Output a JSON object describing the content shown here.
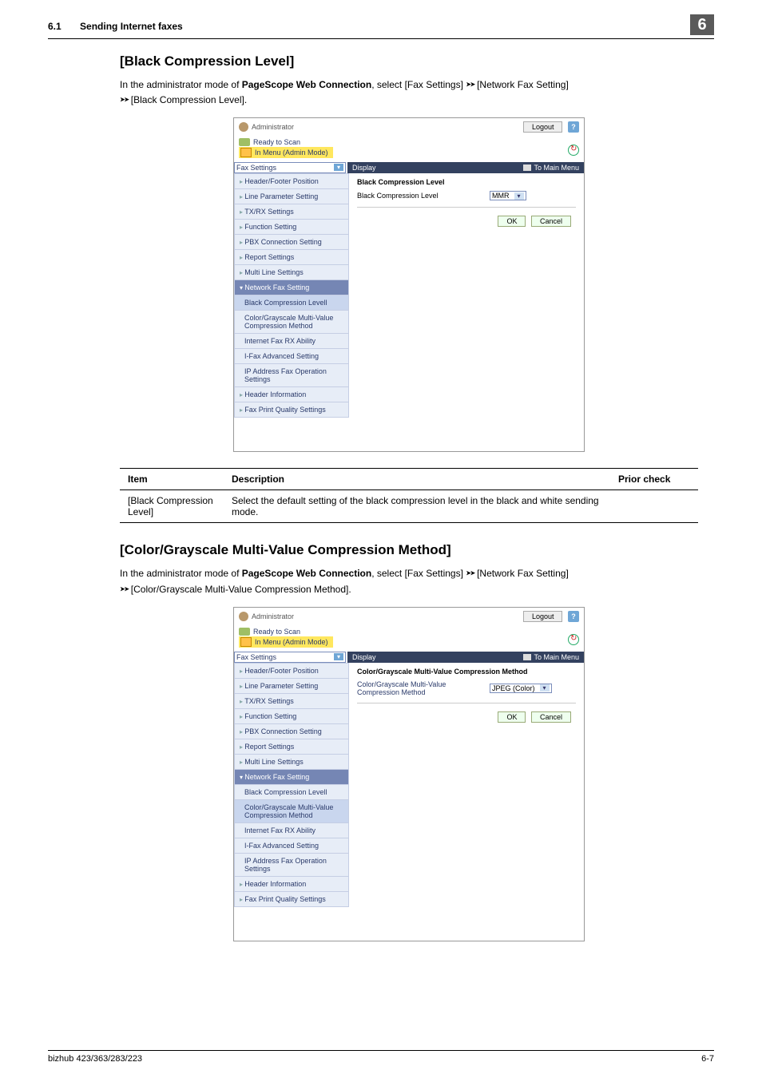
{
  "header": {
    "section_no": "6.1",
    "section_title": "Sending Internet faxes",
    "chapter_no": "6"
  },
  "section1": {
    "title": "[Black Compression Level]",
    "intro_a": "In the administrator mode of ",
    "intro_bold": "PageScope Web Connection",
    "intro_b": ", select [Fax Settings]",
    "arrow": "➤➤",
    "intro_c": " [Network Fax Setting]",
    "intro_d": " [Black Compression Level].",
    "shot": {
      "admin_label": "Administrator",
      "logout": "Logout",
      "help": "?",
      "ready": "Ready to Scan",
      "in_menu": "In Menu (Admin Mode)",
      "select": "Fax Settings",
      "display": "Display",
      "to_main": "To Main Menu",
      "sidebar": [
        "Header/Footer Position",
        "Line Parameter Setting",
        "TX/RX Settings",
        "Function Setting",
        "PBX Connection Setting",
        "Report Settings",
        "Multi Line Settings",
        "Network Fax Setting",
        "Black Compression Levell",
        "Color/Grayscale Multi-Value Compression Method",
        "Internet Fax RX Ability",
        "I-Fax Advanced Setting",
        "IP Address Fax Operation Settings",
        "Header Information",
        "Fax Print Quality Settings"
      ],
      "content_title": "Black Compression Level",
      "field_label": "Black Compression Level",
      "field_value": "MMR",
      "ok": "OK",
      "cancel": "Cancel"
    },
    "table": {
      "h1": "Item",
      "h2": "Description",
      "h3": "Prior check",
      "r1c1": "[Black Compres­sion Level]",
      "r1c2": "Select the default setting of the black compression level in the black and white sending mode.",
      "r1c3": ""
    }
  },
  "section2": {
    "title": "[Color/Grayscale Multi-Value Compression Method]",
    "intro_a": "In the administrator mode of ",
    "intro_bold": "PageScope Web Connection",
    "intro_b": ", select [Fax Settings]",
    "arrow": "➤➤",
    "intro_c": " [Network Fax Setting]",
    "intro_d": " [Color/Grayscale Multi-Value Compression Method].",
    "shot": {
      "admin_label": "Administrator",
      "logout": "Logout",
      "help": "?",
      "ready": "Ready to Scan",
      "in_menu": "In Menu (Admin Mode)",
      "select": "Fax Settings",
      "display": "Display",
      "to_main": "To Main Menu",
      "sidebar": [
        "Header/Footer Position",
        "Line Parameter Setting",
        "TX/RX Settings",
        "Function Setting",
        "PBX Connection Setting",
        "Report Settings",
        "Multi Line Settings",
        "Network Fax Setting",
        "Black Compression Levell",
        "Color/Grayscale Multi-Value Compression Method",
        "Internet Fax RX Ability",
        "I-Fax Advanced Setting",
        "IP Address Fax Operation Settings",
        "Header Information",
        "Fax Print Quality Settings"
      ],
      "content_title": "Color/Grayscale Multi-Value Compression Method",
      "field_label": "Color/Grayscale Multi-Value Compression Method",
      "field_value": "JPEG (Color)",
      "ok": "OK",
      "cancel": "Cancel"
    }
  },
  "footer": {
    "left": "bizhub 423/363/283/223",
    "right": "6-7"
  }
}
